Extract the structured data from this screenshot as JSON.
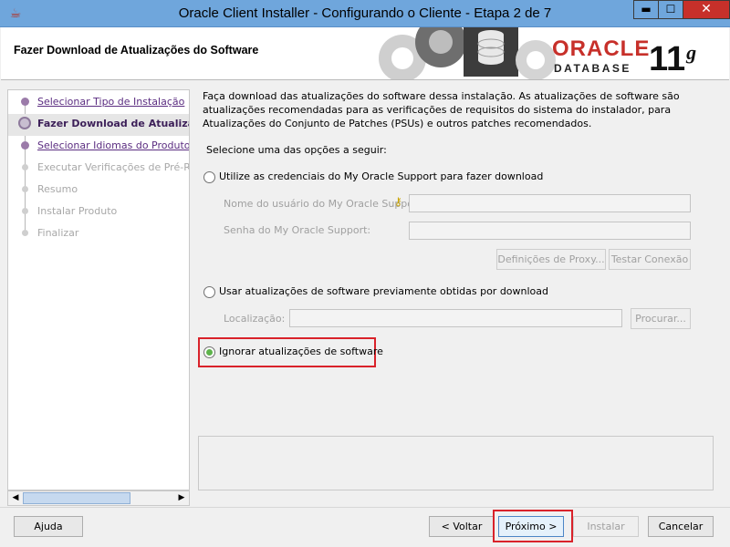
{
  "window": {
    "title": "Oracle Client Installer - Configurando o Cliente - Etapa 2 de 7",
    "minimize_glyph": "▬",
    "maximize_glyph": "☐",
    "close_glyph": "✕"
  },
  "header": {
    "page_title": "Fazer Download de Atualizações do Software",
    "brand": "ORACLE",
    "product": "DATABASE",
    "version": "11",
    "version_suffix": "g"
  },
  "nav": {
    "items": [
      {
        "label": "Selecionar Tipo de Instalação",
        "state": "link"
      },
      {
        "label": "Fazer Download de Atualizações do Software",
        "state": "current"
      },
      {
        "label": "Selecionar Idiomas do Produto",
        "state": "link"
      },
      {
        "label": "Executar Verificações de Pré-Requisitos",
        "state": "disabled"
      },
      {
        "label": "Resumo",
        "state": "disabled"
      },
      {
        "label": "Instalar Produto",
        "state": "disabled"
      },
      {
        "label": "Finalizar",
        "state": "disabled"
      }
    ]
  },
  "content": {
    "description": "Faça download das atualizações do software dessa instalação. As atualizações de software são atualizações recomendadas para as verificações de requisitos do sistema do instalador, para Atualizações do Conjunto de Patches (PSUs) e outros patches recomendados.",
    "select_prompt": "Selecione uma das opções a seguir:",
    "option_mos": "Utilize as credenciais do My Oracle Support para fazer download",
    "username_label": "Nome do usuário do My Oracle Support:",
    "username_value": "",
    "password_label": "Senha do My Oracle Support:",
    "password_value": "",
    "proxy_button": "Definições de Proxy...",
    "test_button": "Testar Conexão",
    "option_previous": "Usar atualizações de software previamente obtidas por download",
    "location_label": "Localização:",
    "location_value": "",
    "browse_button": "Procurar...",
    "option_skip": "Ignorar atualizações de software",
    "selected_option": "skip"
  },
  "footer": {
    "help": "Ajuda",
    "back": "< Voltar",
    "next": "Próximo >",
    "install": "Instalar",
    "cancel": "Cancelar"
  },
  "colors": {
    "titlebar": "#6fa6dc",
    "close_button": "#c7302a",
    "oracle_red": "#c7302a",
    "nav_link": "#5b2d81",
    "highlight": "#d9222a",
    "radio_selected": "#5db34b"
  }
}
